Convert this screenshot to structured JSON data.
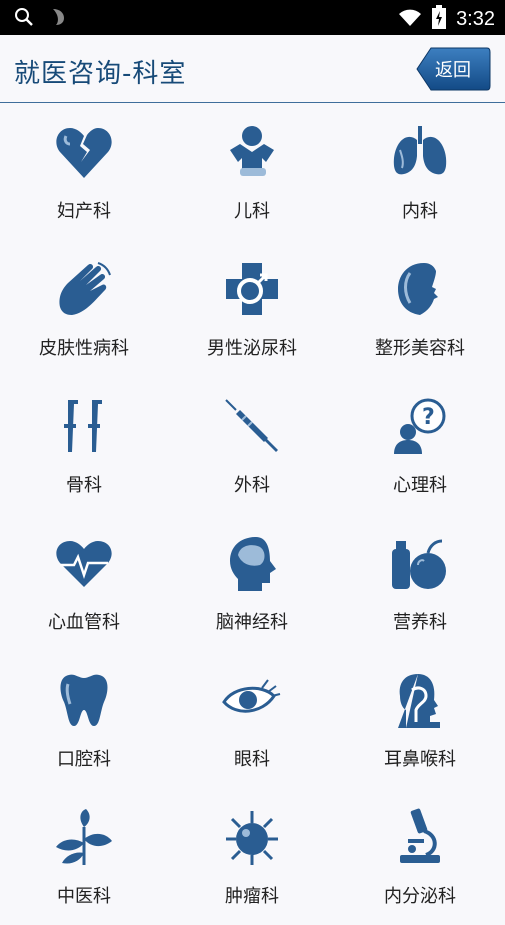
{
  "status_bar": {
    "time": "3:32"
  },
  "header": {
    "title": "就医咨询-科室",
    "back_label": "返回"
  },
  "departments": [
    {
      "label": "妇产科",
      "icon": "broken-heart-icon"
    },
    {
      "label": "儿科",
      "icon": "child-icon"
    },
    {
      "label": "内科",
      "icon": "lungs-icon"
    },
    {
      "label": "皮肤性病科",
      "icon": "hand-icon"
    },
    {
      "label": "男性泌尿科",
      "icon": "male-cross-icon"
    },
    {
      "label": "整形美容科",
      "icon": "face-profile-icon"
    },
    {
      "label": "骨科",
      "icon": "crutches-icon"
    },
    {
      "label": "外科",
      "icon": "syringe-icon"
    },
    {
      "label": "心理科",
      "icon": "question-person-icon"
    },
    {
      "label": "心血管科",
      "icon": "heartbeat-icon"
    },
    {
      "label": "脑神经科",
      "icon": "head-brain-icon"
    },
    {
      "label": "营养科",
      "icon": "apple-bottle-icon"
    },
    {
      "label": "口腔科",
      "icon": "tooth-icon"
    },
    {
      "label": "眼科",
      "icon": "eye-icon"
    },
    {
      "label": "耳鼻喉科",
      "icon": "ent-head-icon"
    },
    {
      "label": "中医科",
      "icon": "herb-icon"
    },
    {
      "label": "肿瘤科",
      "icon": "virus-icon"
    },
    {
      "label": "内分泌科",
      "icon": "microscope-icon"
    }
  ],
  "colors": {
    "primary": "#174a78",
    "icon_blue": "#2a5d92",
    "icon_light": "#9dbbd9"
  }
}
